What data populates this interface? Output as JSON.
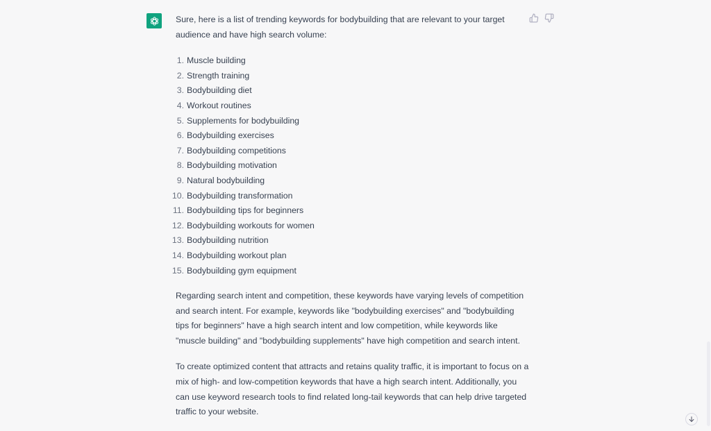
{
  "assistant": {
    "avatar_icon": "openai-logo-icon",
    "brand_color": "#10a37f",
    "intro": "Sure, here is a list of trending keywords for bodybuilding that are relevant to your target audience and have high search volume:",
    "keywords": [
      {
        "num": "1.",
        "text": "Muscle building"
      },
      {
        "num": "2.",
        "text": "Strength training"
      },
      {
        "num": "3.",
        "text": "Bodybuilding diet"
      },
      {
        "num": "4.",
        "text": "Workout routines"
      },
      {
        "num": "5.",
        "text": "Supplements for bodybuilding"
      },
      {
        "num": "6.",
        "text": "Bodybuilding exercises"
      },
      {
        "num": "7.",
        "text": "Bodybuilding competitions"
      },
      {
        "num": "8.",
        "text": "Bodybuilding motivation"
      },
      {
        "num": "9.",
        "text": "Natural bodybuilding"
      },
      {
        "num": "10.",
        "text": "Bodybuilding transformation"
      },
      {
        "num": "11.",
        "text": "Bodybuilding tips for beginners"
      },
      {
        "num": "12.",
        "text": "Bodybuilding workouts for women"
      },
      {
        "num": "13.",
        "text": "Bodybuilding nutrition"
      },
      {
        "num": "14.",
        "text": "Bodybuilding workout plan"
      },
      {
        "num": "15.",
        "text": "Bodybuilding gym equipment"
      }
    ],
    "paragraph_1": "Regarding search intent and competition, these keywords have varying levels of competition and search intent. For example, keywords like \"bodybuilding exercises\" and \"bodybuilding tips for beginners\" have a high search intent and low competition, while keywords like \"muscle building\" and \"bodybuilding supplements\" have high competition and search intent.",
    "paragraph_2": "To create optimized content that attracts and retains quality traffic, it is important to focus on a mix of high- and low-competition keywords that have a high search intent. Additionally, you can use keyword research tools to find related long-tail keywords that can help drive targeted traffic to your website."
  },
  "feedback": {
    "thumbs_up_icon": "thumbs-up-icon",
    "thumbs_down_icon": "thumbs-down-icon"
  },
  "scroll": {
    "icon": "arrow-down-icon"
  }
}
